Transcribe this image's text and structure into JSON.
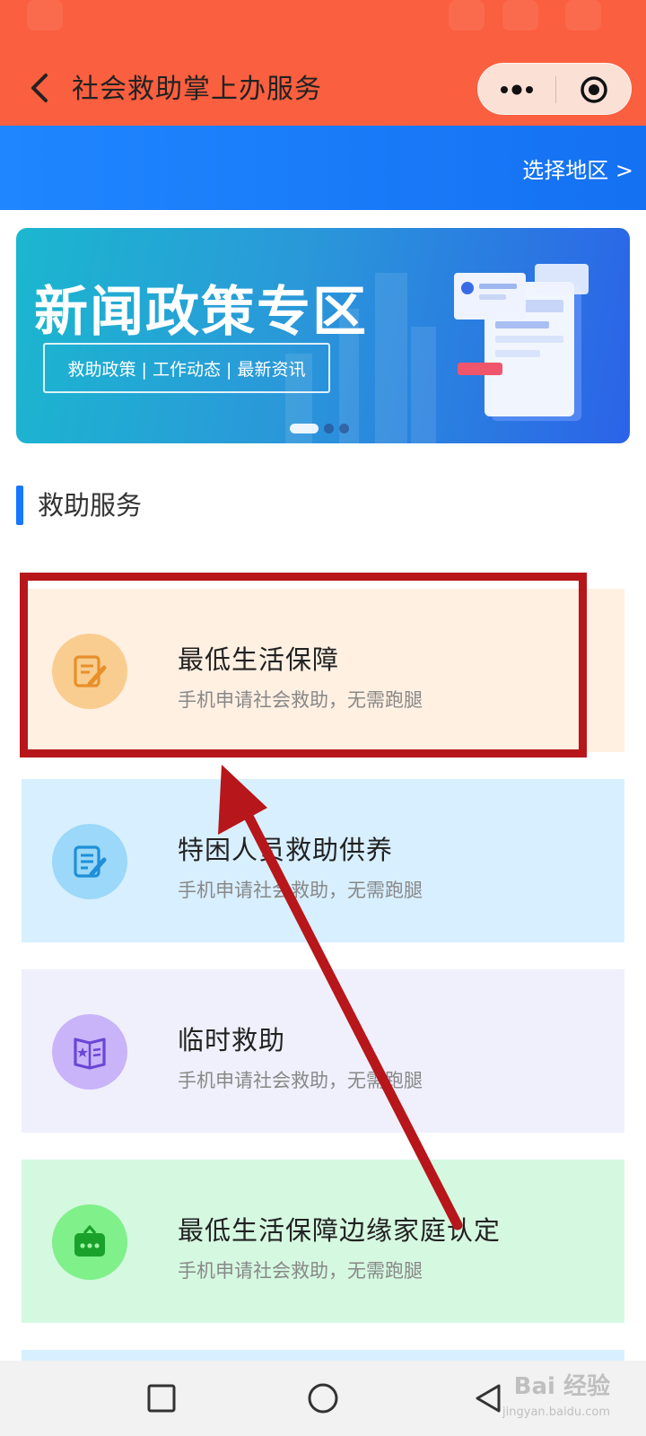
{
  "nav": {
    "title": "社会救助掌上办服务",
    "back_icon": "chevron-left-icon",
    "more_icon": "more-dots-icon",
    "close_icon": "target-circle-icon",
    "bg_color": "#fa5f3f"
  },
  "region": {
    "label": "选择地区 >",
    "bg_color": "#1f86ff"
  },
  "banner": {
    "title": "新闻政策专区",
    "subtitle": "救助政策 | 工作动态 | 最新资讯",
    "slide_count": 3,
    "active_slide": 1
  },
  "section": {
    "title": "救助服务",
    "accent_color": "#1677ff"
  },
  "services": [
    {
      "title": "最低生活保障",
      "desc": "手机申请社会救助，无需跑腿",
      "icon": "form-edit-icon",
      "icon_color": "#f7b163",
      "bg_color": "#fff0e2",
      "highlighted": true
    },
    {
      "title": "特困人员救助供养",
      "desc": "手机申请社会救助，无需跑腿",
      "icon": "document-edit-icon",
      "icon_color": "#6cc3f4",
      "bg_color": "#d8efff",
      "highlighted": false
    },
    {
      "title": "临时救助",
      "desc": "手机申请社会救助，无需跑腿",
      "icon": "star-book-icon",
      "icon_color": "#a887f2",
      "bg_color": "#f0f0fc",
      "highlighted": false
    },
    {
      "title": "最低生活保障边缘家庭认定",
      "desc": "手机申请社会救助，无需跑腿",
      "icon": "chat-bag-icon",
      "icon_color": "#5fe06a",
      "bg_color": "#d5f8e0",
      "highlighted": false
    }
  ],
  "annotation": {
    "color": "#b7161a"
  },
  "system_nav": {
    "recents_icon": "square-icon",
    "home_icon": "circle-icon",
    "back_icon": "triangle-back-icon"
  },
  "watermark": {
    "text": "Bai 经验",
    "sub": "jingyan.baidu.com"
  }
}
